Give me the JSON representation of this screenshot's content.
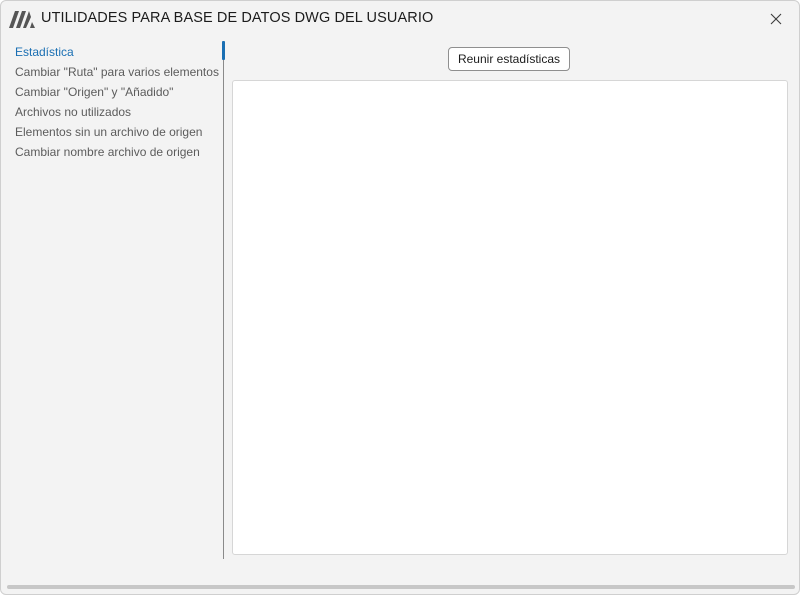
{
  "window": {
    "title": "UTILIDADES PARA BASE DE DATOS DWG DEL USUARIO",
    "logo_icon": "app-logo-icon",
    "close_icon": "close-icon"
  },
  "sidebar": {
    "items": [
      {
        "label": "Estadística",
        "active": true
      },
      {
        "label": "Cambiar \"Ruta\" para varios elementos",
        "active": false
      },
      {
        "label": "Cambiar \"Origen\" y \"Añadido\"",
        "active": false
      },
      {
        "label": "Archivos no utilizados",
        "active": false
      },
      {
        "label": "Elementos sin un archivo de origen",
        "active": false
      },
      {
        "label": "Cambiar nombre archivo de origen",
        "active": false
      }
    ]
  },
  "main": {
    "gather_button_label": "Reunir estadísticas",
    "results_text": ""
  },
  "colors": {
    "accent": "#1a6fb3",
    "window_bg": "#f3f3f3",
    "panel_bg": "#ffffff"
  }
}
